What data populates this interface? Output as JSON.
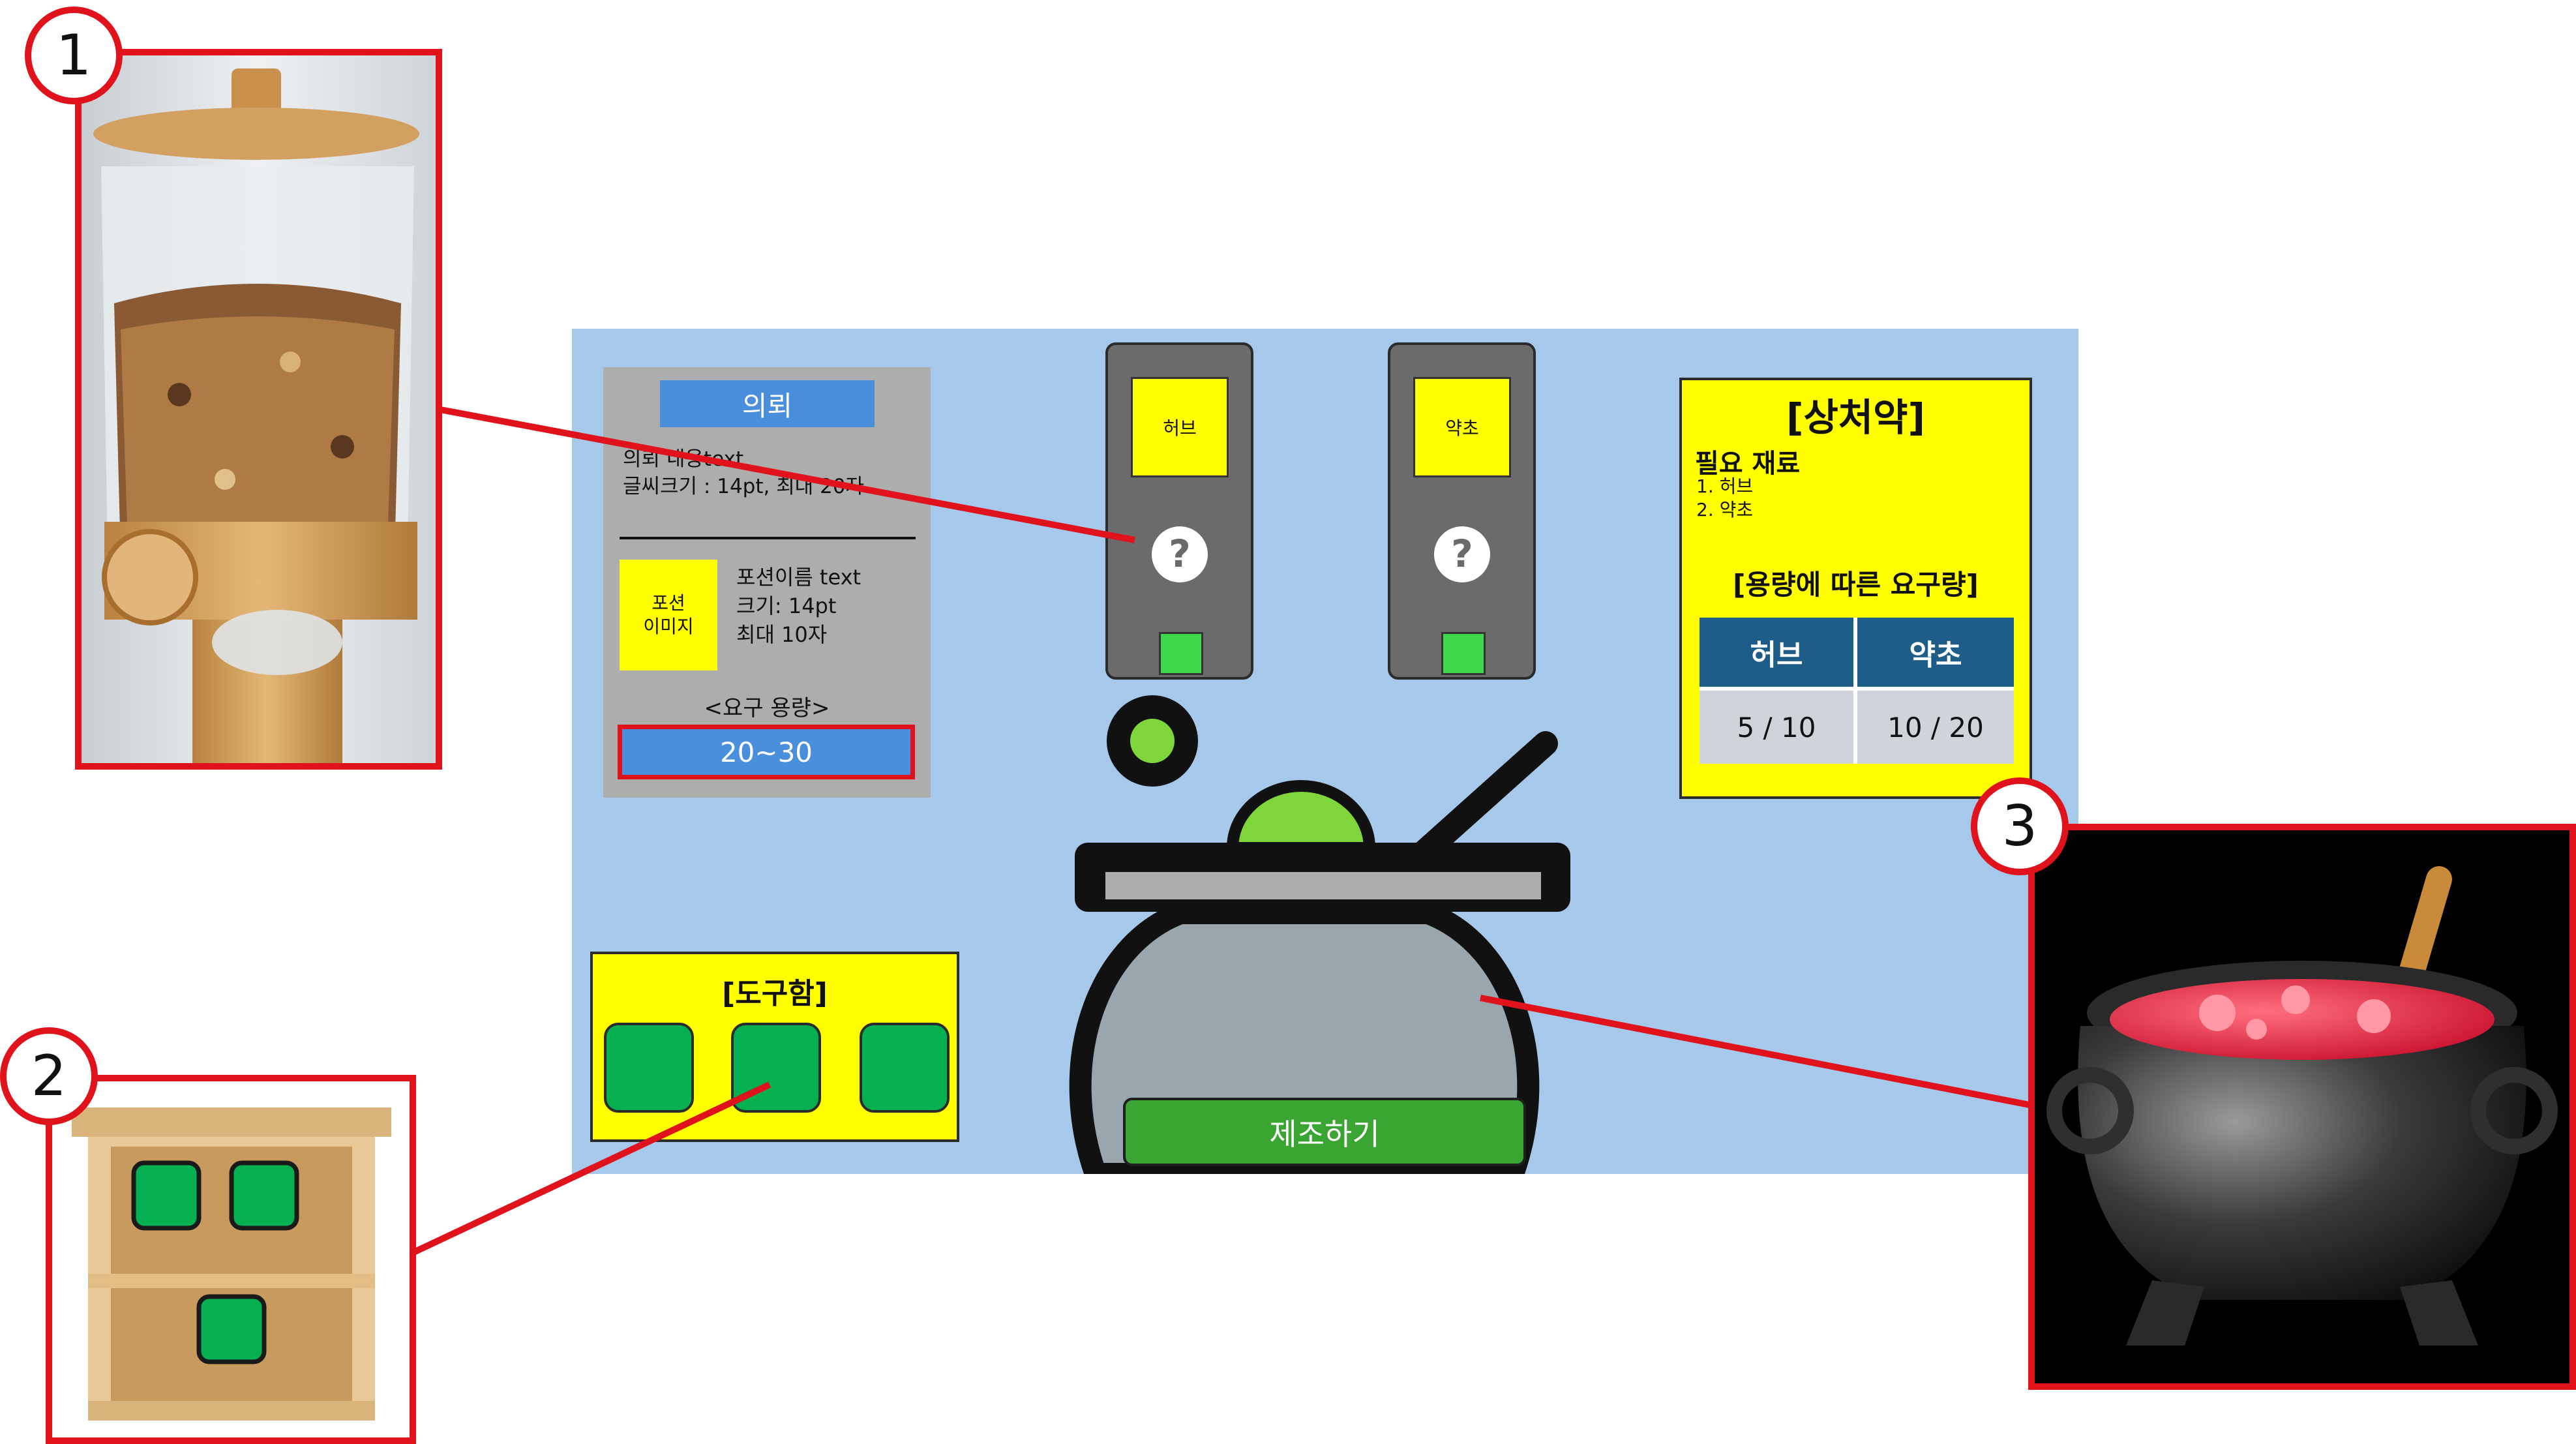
{
  "request_panel": {
    "title": "의뢰",
    "content": "의뢰 내용text\n글씨크기 : 14pt, 최대 20자",
    "potion_image_label": "포션\n이미지",
    "potion_info": "포션이름 text\n크기: 14pt\n최대 10자",
    "required_label": "<요구 용량>",
    "required_value": "20~30"
  },
  "dispensers": [
    {
      "ingredient": "허브",
      "icon": "question-icon"
    },
    {
      "ingredient": "약초",
      "icon": "question-icon"
    }
  ],
  "recipe": {
    "title": "[상처약]",
    "subtitle": "필요 재료",
    "ingredients": "1. 허브\n2. 약초",
    "requirement_title": "[용량에 따른 요구량]",
    "table": {
      "headers": [
        "허브",
        "약초"
      ],
      "values": [
        "5 / 10",
        "10 / 20"
      ]
    }
  },
  "toolbox": {
    "title": "[도구함]",
    "slots": 3
  },
  "craft_button_label": "제조하기",
  "callouts": [
    {
      "number": "1",
      "reference": "cereal-dispenser"
    },
    {
      "number": "2",
      "reference": "wooden-shelf"
    },
    {
      "number": "3",
      "reference": "witch-cauldron"
    }
  ],
  "colors": {
    "game_bg": "#a6c9eb",
    "panel_yellow": "#ffff00",
    "callout_red": "#e0121b",
    "slot_green": "#04b050",
    "table_header": "#1d5d87"
  }
}
